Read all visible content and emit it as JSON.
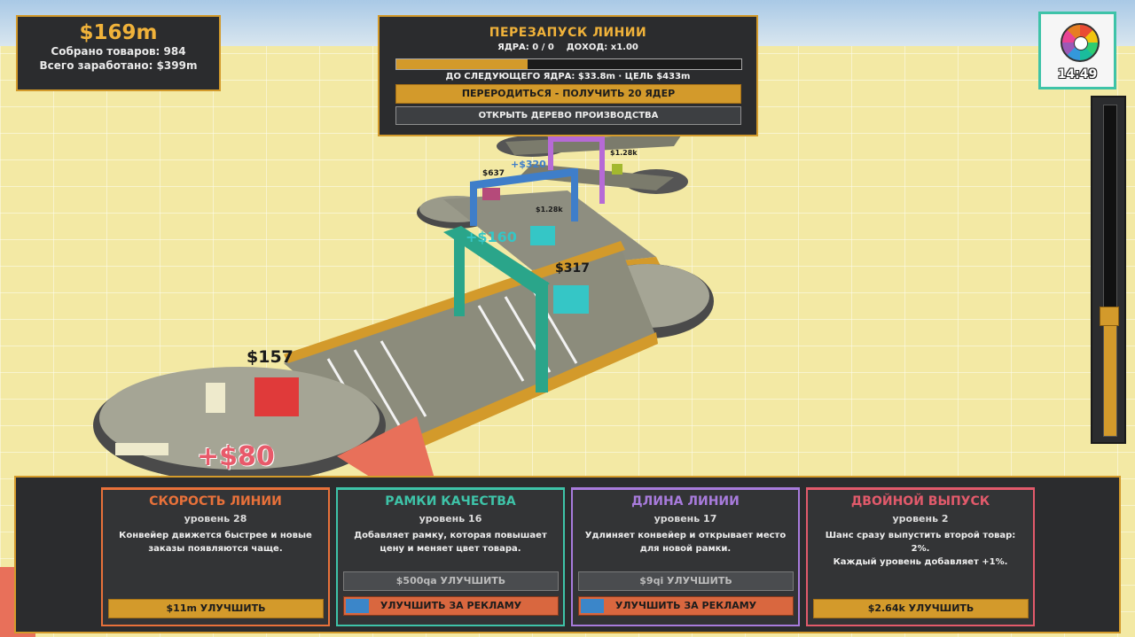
{
  "stats": {
    "money": "$169m",
    "collected": "Собрано товаров: 984",
    "earned_total": "Всего заработано: $399m"
  },
  "prestige": {
    "title": "ПЕРЕЗАПУСК ЛИНИИ",
    "cores_income": "ЯДРА: 0 / 0    ДОХОД: x1.00",
    "progress_fraction": 0.38,
    "next_goal": "ДО СЛЕДУЮЩЕГО ЯДРА: $33.8m  ·  ЦЕЛЬ $433m",
    "rebirth_label": "ПЕРЕРОДИТЬСЯ  -  ПОЛУЧИТЬ 20 ЯДЕР",
    "tree_label": "ОТКРЫТЬ ДЕРЕВО ПРОИЗВОДСТВА"
  },
  "timer": {
    "time": "14:49",
    "icon": "color-wheel-icon"
  },
  "slider": {
    "level_fraction": 0.36
  },
  "scene_labels": {
    "price_1": "$157",
    "gain_1": "+$80",
    "price_2": "$317",
    "gain_2": "+$160",
    "price_3": "$637",
    "gain_3": "+$320",
    "price_4": "$1.28k",
    "price_5": "$1.28k"
  },
  "upgrades": [
    {
      "title": "СКОРОСТЬ ЛИНИИ",
      "color": "#e8713a",
      "level": "уровень 28",
      "desc1": "Конвейер движется быстрее и новые",
      "desc2": "заказы появляются чаще.",
      "buy": "$11m  УЛУЧШИТЬ"
    },
    {
      "title": "РАМКИ КАЧЕСТВА",
      "color": "#3ec3a8",
      "level": "уровень 16",
      "desc1": "Добавляет рамку, которая повышает",
      "desc2": "цену и меняет цвет товара.",
      "buy": "$500qa  УЛУЧШИТЬ",
      "ad": "УЛУЧШИТЬ ЗА РЕКЛАМУ"
    },
    {
      "title": "ДЛИНА ЛИНИИ",
      "color": "#a87bdc",
      "level": "уровень 17",
      "desc1": "Удлиняет конвейер и открывает место",
      "desc2": "для новой рамки.",
      "buy": "$9qi  УЛУЧШИТЬ",
      "ad": "УЛУЧШИТЬ ЗА РЕКЛАМУ"
    },
    {
      "title": "ДВОЙНОЙ ВЫПУСК",
      "color": "#e25a6b",
      "level": "уровень 2",
      "desc1": "Шанс сразу выпустить второй товар: 2%.",
      "desc2": "Каждый уровень добавляет +1%.",
      "buy": "$2.64k  УЛУЧШИТЬ"
    }
  ]
}
